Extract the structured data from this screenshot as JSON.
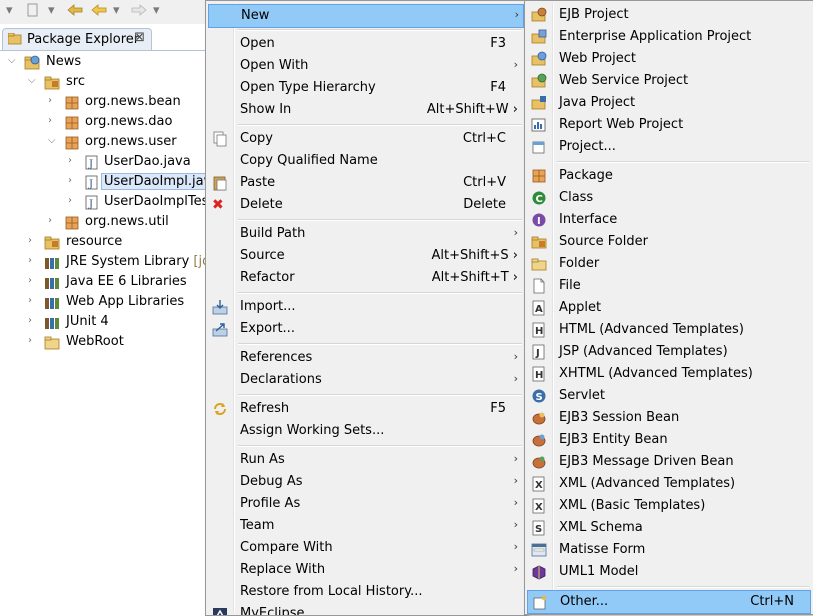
{
  "toolbar": {
    "icons": [
      "navigate-dropdown-icon",
      "back-nav-icon",
      "forward-nav-icon"
    ]
  },
  "explorer": {
    "tab_title": "Package Explorer",
    "tab_close": "⊠",
    "items": [
      {
        "label": "News"
      },
      {
        "label": "src"
      },
      {
        "label": "org.news.bean"
      },
      {
        "label": "org.news.dao"
      },
      {
        "label": "org.news.user"
      },
      {
        "label": "UserDao.java"
      },
      {
        "label": "UserDaoImpl.java"
      },
      {
        "label": "UserDaoImplTest"
      },
      {
        "label": "org.news.util"
      },
      {
        "label": "resource"
      },
      {
        "label": "JRE System Library",
        "suffix": "[jdk"
      },
      {
        "label": "Java EE 6 Libraries"
      },
      {
        "label": "Web App Libraries"
      },
      {
        "label": "JUnit 4"
      },
      {
        "label": "WebRoot"
      }
    ]
  },
  "context_menu": {
    "items": [
      {
        "label": "New",
        "sub": "›"
      },
      {
        "label": "Open",
        "shortcut": "F3"
      },
      {
        "label": "Open With",
        "sub": "›"
      },
      {
        "label": "Open Type Hierarchy",
        "shortcut": "F4"
      },
      {
        "label": "Show In",
        "shortcut": "Alt+Shift+W ›"
      },
      {
        "label": "Copy",
        "shortcut": "Ctrl+C"
      },
      {
        "label": "Copy Qualified Name"
      },
      {
        "label": "Paste",
        "shortcut": "Ctrl+V"
      },
      {
        "label": "Delete",
        "shortcut": "Delete"
      },
      {
        "label": "Build Path",
        "sub": "›"
      },
      {
        "label": "Source",
        "shortcut": "Alt+Shift+S ›"
      },
      {
        "label": "Refactor",
        "shortcut": "Alt+Shift+T ›"
      },
      {
        "label": "Import..."
      },
      {
        "label": "Export..."
      },
      {
        "label": "References",
        "sub": "›"
      },
      {
        "label": "Declarations",
        "sub": "›"
      },
      {
        "label": "Refresh",
        "shortcut": "F5"
      },
      {
        "label": "Assign Working Sets..."
      },
      {
        "label": "Run As",
        "sub": "›"
      },
      {
        "label": "Debug As",
        "sub": "›"
      },
      {
        "label": "Profile As",
        "sub": "›"
      },
      {
        "label": "Team",
        "sub": "›"
      },
      {
        "label": "Compare With",
        "sub": "›"
      },
      {
        "label": "Replace With",
        "sub": "›"
      },
      {
        "label": "Restore from Local History..."
      },
      {
        "label": "MyEclipse"
      }
    ]
  },
  "new_menu": {
    "items": [
      {
        "label": "EJB Project"
      },
      {
        "label": "Enterprise Application Project"
      },
      {
        "label": "Web Project"
      },
      {
        "label": "Web Service Project"
      },
      {
        "label": "Java Project"
      },
      {
        "label": "Report Web Project"
      },
      {
        "label": "Project..."
      },
      {
        "label": "Package"
      },
      {
        "label": "Class"
      },
      {
        "label": "Interface"
      },
      {
        "label": "Source Folder"
      },
      {
        "label": "Folder"
      },
      {
        "label": "File"
      },
      {
        "label": "Applet"
      },
      {
        "label": "HTML (Advanced Templates)"
      },
      {
        "label": "JSP (Advanced Templates)"
      },
      {
        "label": "XHTML (Advanced Templates)"
      },
      {
        "label": "Servlet"
      },
      {
        "label": "EJB3 Session Bean"
      },
      {
        "label": "EJB3 Entity Bean"
      },
      {
        "label": "EJB3 Message Driven Bean"
      },
      {
        "label": "XML (Advanced Templates)"
      },
      {
        "label": "XML (Basic Templates)"
      },
      {
        "label": "XML Schema"
      },
      {
        "label": "Matisse Form"
      },
      {
        "label": "UML1 Model"
      },
      {
        "label": "Other...",
        "shortcut": "Ctrl+N"
      }
    ]
  },
  "icon_glyphs": {
    "delete": "✖",
    "interface": "I",
    "class": "C",
    "java_file": "J",
    "applet": "A",
    "html": "H",
    "xhtml": "H",
    "jsp": "J",
    "xml": "X",
    "schema": "S",
    "servlet": "S"
  },
  "colors": {
    "highlight": "#91c9f7",
    "highlight_border": "#62a2e4",
    "menu_bg": "#f0f0f0",
    "selection": "#dbe8fa"
  }
}
